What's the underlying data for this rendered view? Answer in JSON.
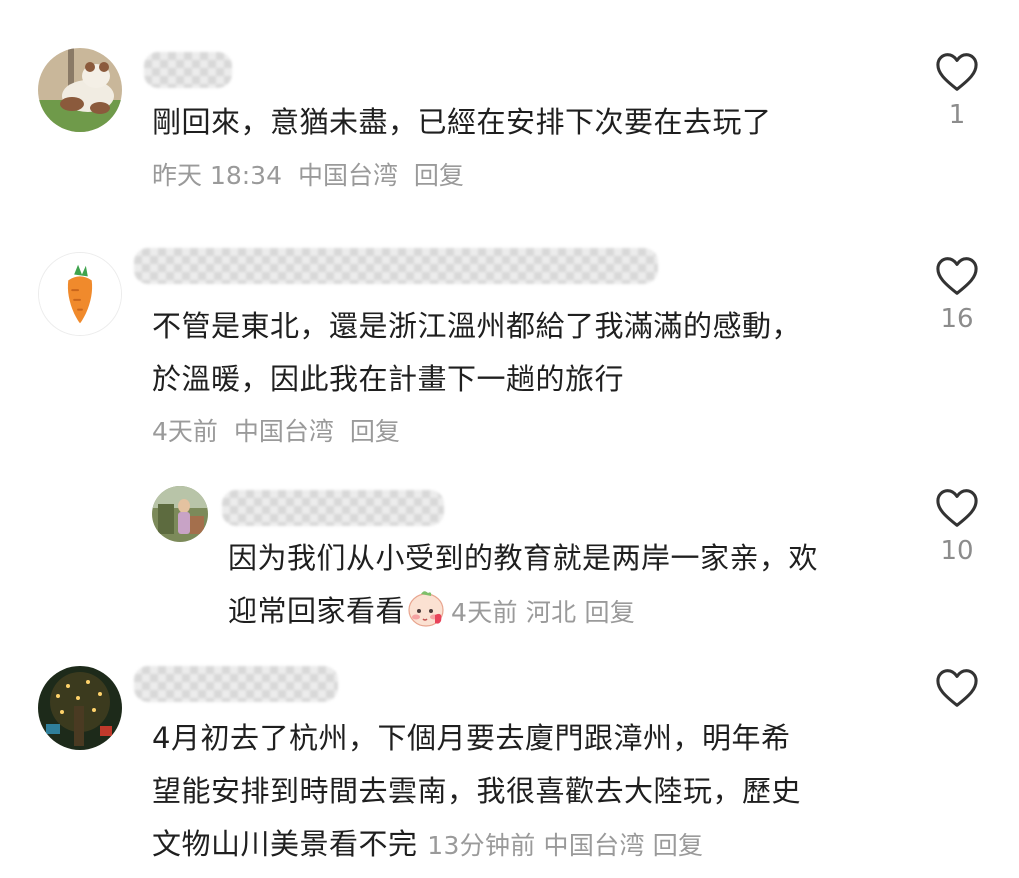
{
  "colors": {
    "text": "#1f1f1f",
    "meta": "#9a9a9a",
    "icon": "#333333",
    "count": "#8c8c8c"
  },
  "comments": [
    {
      "avatar_icon": "panda-avatar-icon",
      "lines": [
        "剛回來，意猶未盡，已經在安排下次要在去玩了"
      ],
      "time": "昨天 18:34",
      "location": "中国台湾",
      "reply_label": "回复",
      "like_count": "1"
    },
    {
      "avatar_icon": "carrot-avatar-icon",
      "lines": [
        "不管是東北，還是浙江溫州都給了我滿滿的感動，",
        "於溫暖，因此我在計畫下一趟的旅行"
      ],
      "time": "4天前",
      "location": "中国台湾",
      "reply_label": "回复",
      "like_count": "16"
    },
    {
      "avatar_icon": "photo-avatar-icon",
      "lines": [
        "因为我们从小受到的教育就是两岸一家亲，欢",
        "迎常回家看看"
      ],
      "emoji": "blushing-face-emoji",
      "time": "4天前",
      "location": "河北",
      "reply_label": "回复",
      "like_count": "10"
    },
    {
      "avatar_icon": "night-tree-avatar-icon",
      "lines": [
        "4月初去了杭州，下個月要去廈門跟漳州，明年希",
        "望能安排到時間去雲南，我很喜歡去大陸玩，歷史",
        "文物山川美景看不完"
      ],
      "time": "13分钟前",
      "location": "中国台湾",
      "reply_label": "回复",
      "like_count": ""
    }
  ]
}
